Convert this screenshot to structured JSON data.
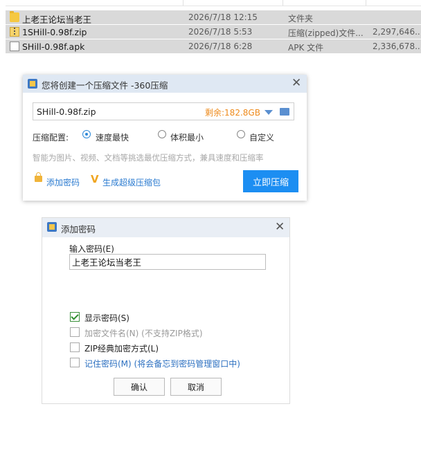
{
  "file_list": {
    "rows": [
      {
        "icon": "folder-icon",
        "name": "上老王论坛当老王",
        "date": "2026/7/18 12:15",
        "type": "文件夹",
        "size": ""
      },
      {
        "icon": "zip-icon",
        "name": "1SHill-0.98f.zip",
        "date": "2026/7/18 5:53",
        "type": "压缩(zipped)文件...",
        "size": "2,297,646..."
      },
      {
        "icon": "apk-file-icon",
        "name": "SHill-0.98f.apk",
        "date": "2026/7/18 6:28",
        "type": "APK 文件",
        "size": "2,336,678..."
      }
    ]
  },
  "compress_dialog": {
    "title": "您将创建一个压缩文件 -360压缩",
    "filename": "SHill-0.98f.zip",
    "free_space": "剩余:182.8GB",
    "config_label": "压缩配置:",
    "options": [
      "速度最快",
      "体积最小",
      "自定义"
    ],
    "selected_option": "速度最快",
    "hint": "智能为图片、视频、文档等挑选最优压缩方式，兼具速度和压缩率",
    "add_password_label": "添加密码",
    "super_pack_label": "生成超级压缩包",
    "compress_button": "立即压缩",
    "accent_color": "#1c8ef2"
  },
  "password_dialog": {
    "title": "添加密码",
    "input_label": "输入密码(E)",
    "password_value": "上老王论坛当老王",
    "checkboxes": [
      {
        "label": "显示密码(S)",
        "checked": true
      },
      {
        "label": "加密文件名(N) (不支持ZIP格式)",
        "checked": false,
        "disabled": true
      },
      {
        "label": "ZIP经典加密方式(L)",
        "checked": false
      },
      {
        "label": "记住密码(M) (将会备忘到密码管理窗口中)",
        "checked": false
      }
    ],
    "ok_button": "确认",
    "cancel_button": "取消"
  }
}
